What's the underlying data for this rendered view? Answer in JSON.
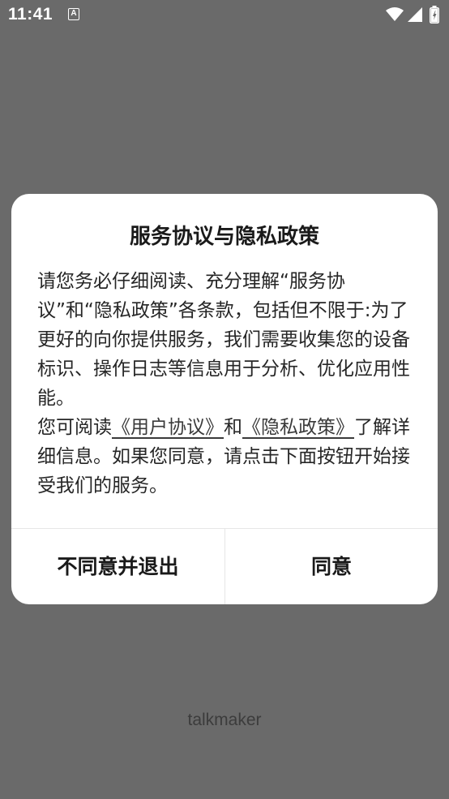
{
  "status_bar": {
    "time": "11:41",
    "notification_icon": "a-notification-icon",
    "wifi_icon": "wifi-icon",
    "signal_icon": "cell-signal-icon",
    "battery_icon": "battery-charging-icon"
  },
  "dialog": {
    "title": "服务协议与隐私政策",
    "paragraph1": "请您务必仔细阅读、充分理解“服务协议”和“隐私政策”各条款，包括但不限于:为了更好的向你提供服务，我们需要收集您的设备标识、操作日志等信息用于分析、优化应用性能。",
    "paragraph2_prefix": "您可阅读",
    "user_agreement_link": "《用户协议》",
    "paragraph2_and": "和",
    "privacy_policy_link": "《隐私政策》",
    "paragraph2_suffix": "了解详细信息。如果您同意，请点击下面按钮开始接受我们的服务。",
    "disagree_button": "不同意并退出",
    "agree_button": "同意"
  },
  "brand": "talkmaker",
  "colors": {
    "overlay": "#6a6a6a",
    "dialog_bg": "#ffffff",
    "text": "#1a1a1a"
  }
}
